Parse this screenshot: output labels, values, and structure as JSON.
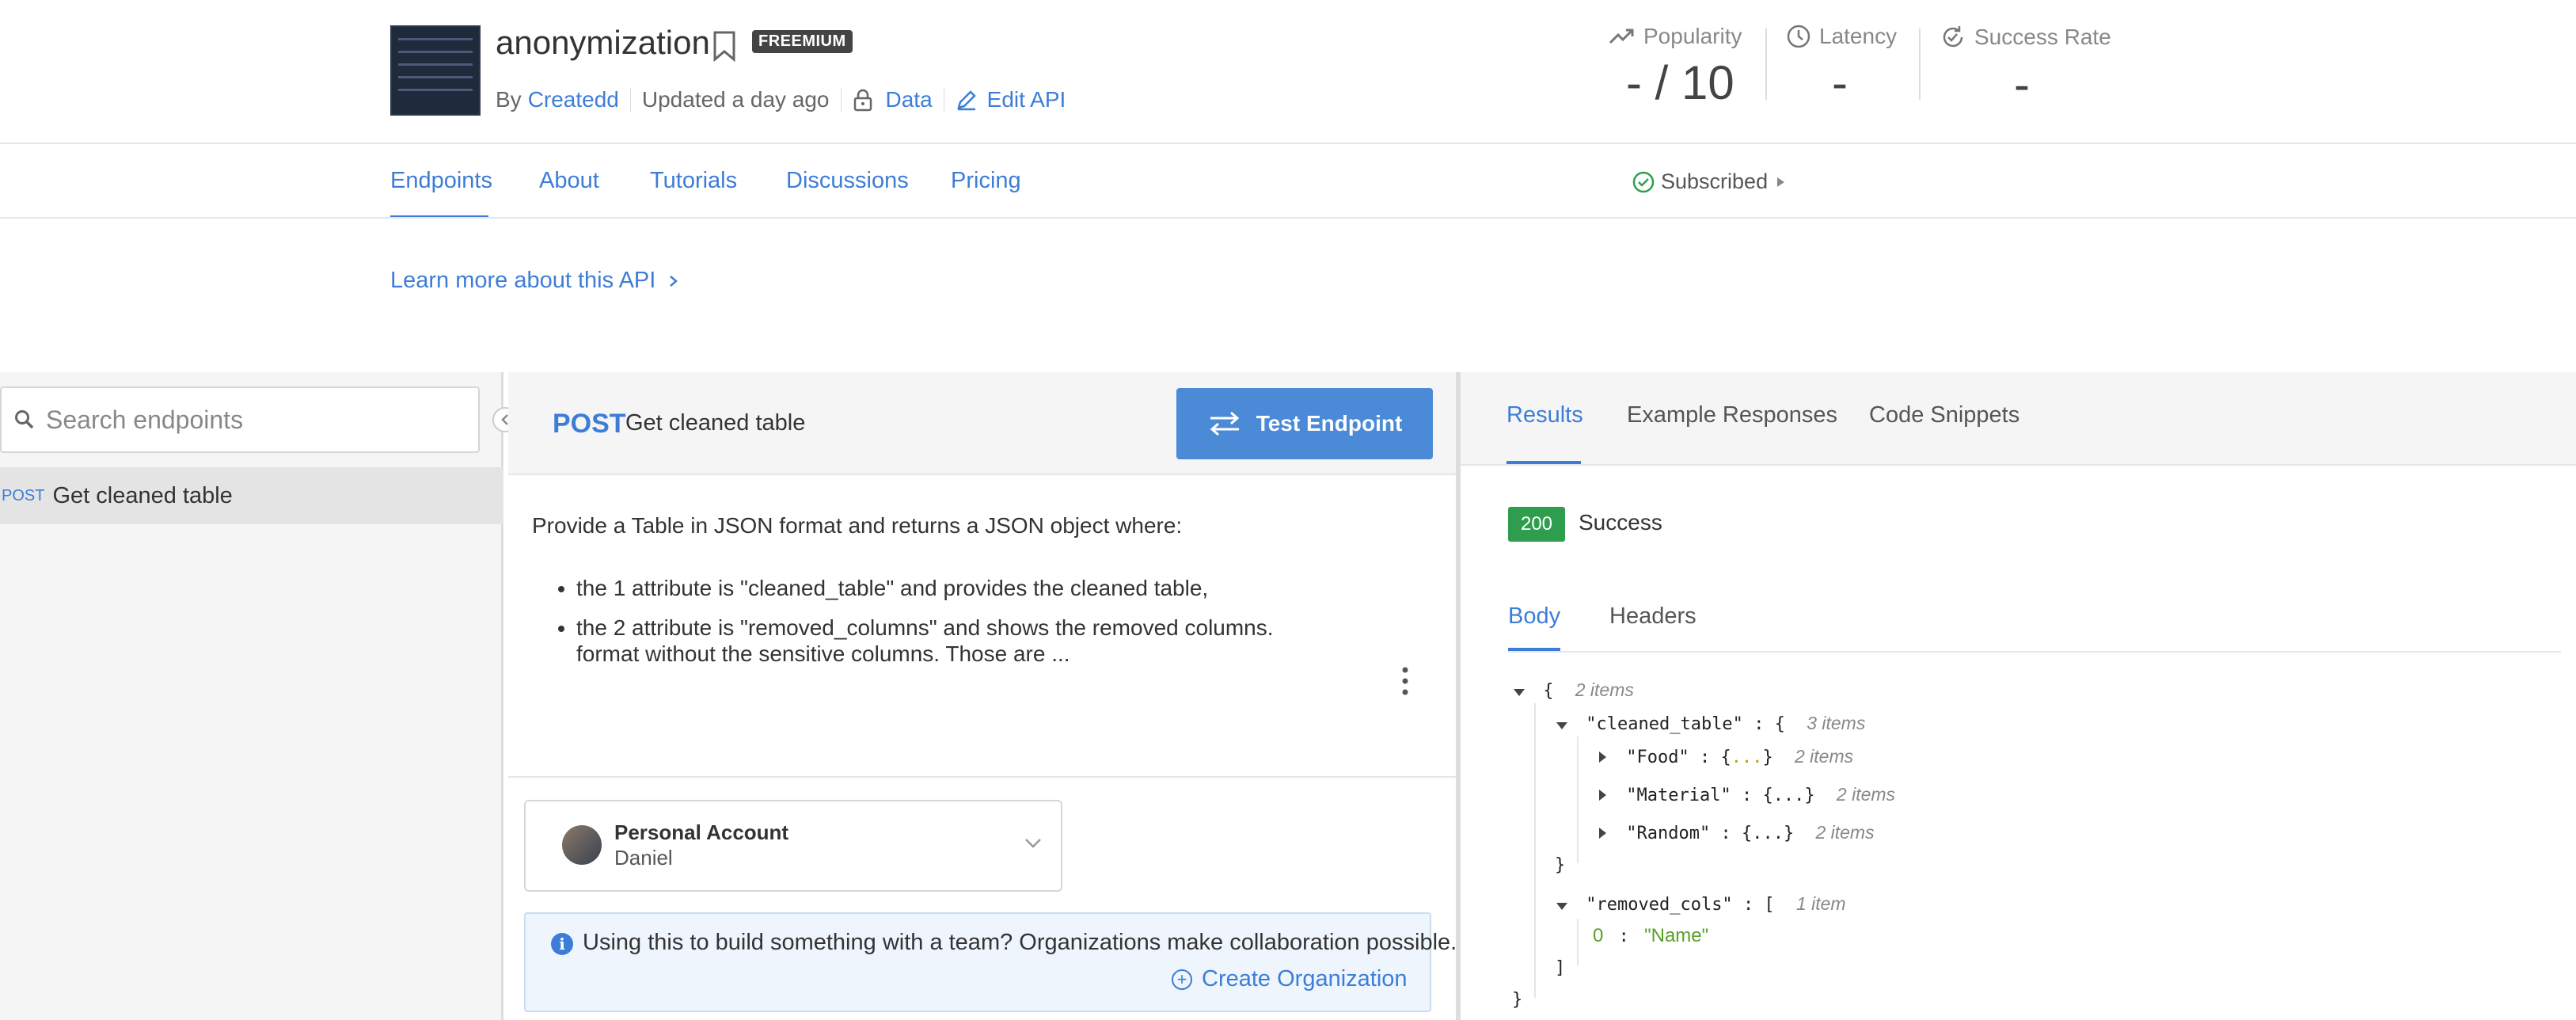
{
  "header": {
    "title": "anonymization",
    "plan_badge": "FREEMIUM",
    "by_label": "By",
    "author": "Createdd",
    "updated": "Updated a day ago",
    "data_link": "Data",
    "edit_link": "Edit API",
    "stats": [
      {
        "label": "Popularity",
        "value": "- / 10",
        "icon": "trend-up-icon"
      },
      {
        "label": "Latency",
        "value": "-",
        "icon": "clock-icon"
      },
      {
        "label": "Success Rate",
        "value": "-",
        "icon": "refresh-check-icon"
      }
    ]
  },
  "nav": {
    "tabs": [
      "Endpoints",
      "About",
      "Tutorials",
      "Discussions",
      "Pricing"
    ],
    "active_tab": "Endpoints",
    "subscribed": "Subscribed"
  },
  "learn_more": "Learn more about this API",
  "sidebar": {
    "search_placeholder": "Search endpoints",
    "endpoints": [
      {
        "method": "POST",
        "name": "Get cleaned table"
      }
    ]
  },
  "endpoint": {
    "method": "POST",
    "name": "Get cleaned table",
    "test_button": "Test Endpoint",
    "description": "Provide a Table in JSON format and returns a JSON object where:",
    "bullets": [
      "the 1 attribute is \"cleaned_table\" and provides the cleaned table,",
      "the 2 attribute is \"removed_columns\" and shows the removed columns."
    ],
    "truncated_line": "format without the sensitive columns. Those are ...",
    "account": {
      "title": "Personal Account",
      "user": "Daniel"
    },
    "org_message": "Using this to build something with a team? Organizations make collaboration possible.",
    "create_org": "Create Organization"
  },
  "results": {
    "tabs": [
      "Results",
      "Example Responses",
      "Code Snippets"
    ],
    "active_tab": "Results",
    "status_code": "200",
    "status_text": "Success",
    "body_tabs": [
      "Body",
      "Headers"
    ],
    "active_body_tab": "Body",
    "json": {
      "root_count": "2 items",
      "cleaned_table_key": "\"cleaned_table\"",
      "cleaned_table_count": "3 items",
      "children": [
        {
          "key": "\"Food\"",
          "count": "2 items"
        },
        {
          "key": "\"Material\"",
          "count": "2 items"
        },
        {
          "key": "\"Random\"",
          "count": "2 items"
        }
      ],
      "removed_key": "\"removed_cols\"",
      "removed_count": "1 item",
      "removed_index": "0",
      "removed_value": "\"Name\""
    }
  },
  "colors": {
    "accent": "#3d7dd8",
    "success": "#2e9e4e",
    "button": "#4a8ad6"
  }
}
